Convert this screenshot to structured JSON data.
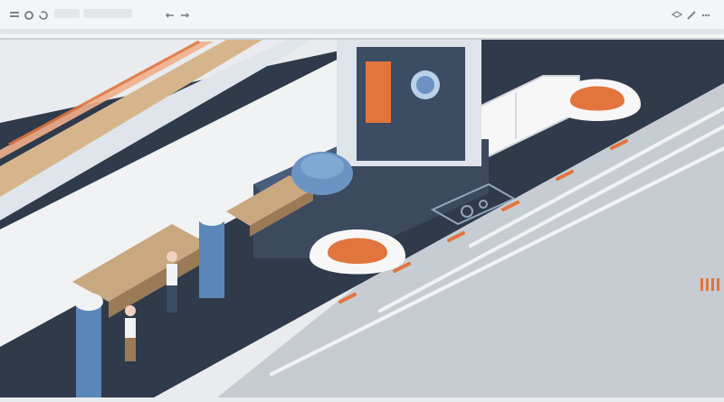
{
  "window": {
    "toolbar_items": [
      {
        "name": "app-menu-icon"
      },
      {
        "name": "settings-icon"
      },
      {
        "name": "refresh-icon"
      },
      {
        "name": "undo-icon"
      },
      {
        "name": "redo-icon"
      },
      {
        "name": "layers-icon"
      },
      {
        "name": "tools-icon"
      },
      {
        "name": "more-icon"
      }
    ]
  },
  "colors": {
    "toolbar_bg": "#f4f5f6",
    "road_dark": "#2f3a4a",
    "blue": "#5b86b8",
    "orange": "#e1753d",
    "wall": "#f1f2f4",
    "slope": "#c6ccd2"
  }
}
